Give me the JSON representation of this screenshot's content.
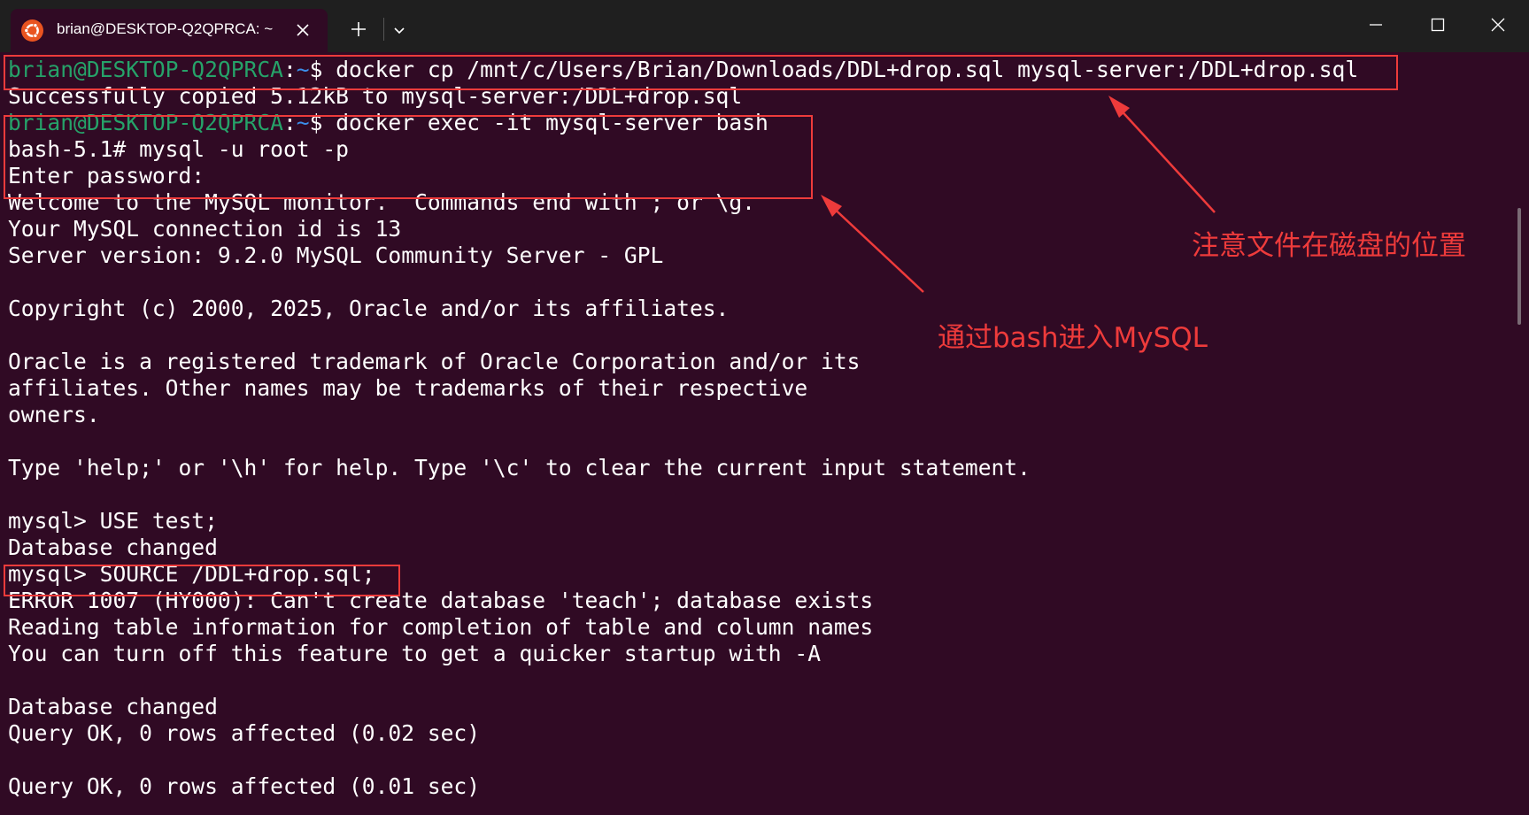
{
  "window": {
    "tab_title": "brian@DESKTOP-Q2QPRCA: ~",
    "tab_icon": "ubuntu-icon",
    "buttons": {
      "close_tab": "close-icon",
      "new_tab": "plus-icon",
      "dropdown": "chevron-down-icon",
      "minimize": "minimize-icon",
      "maximize": "maximize-icon",
      "close": "close-icon"
    }
  },
  "colors": {
    "terminal_bg": "#300a24",
    "prompt_user": "#26a269",
    "prompt_path": "#3b8eea",
    "annotation": "#ee3b3b"
  },
  "terminal": {
    "prompt": {
      "user": "brian@DESKTOP-Q2QPRCA",
      "sep": ":",
      "path": "~",
      "symbol": "$ "
    },
    "cmd1": "docker cp /mnt/c/Users/Brian/Downloads/DDL+drop.sql mysql-server:/DDL+drop.sql",
    "cmd2": "docker exec -it mysql-server bash",
    "lines": [
      "Successfully copied 5.12kB to mysql-server:/DDL+drop.sql",
      "bash-5.1# mysql -u root -p",
      "Enter password:",
      "Welcome to the MySQL monitor.  Commands end with ; or \\g.",
      "Your MySQL connection id is 13",
      "Server version: 9.2.0 MySQL Community Server - GPL",
      "",
      "Copyright (c) 2000, 2025, Oracle and/or its affiliates.",
      "",
      "Oracle is a registered trademark of Oracle Corporation and/or its",
      "affiliates. Other names may be trademarks of their respective",
      "owners.",
      "",
      "Type 'help;' or '\\h' for help. Type '\\c' to clear the current input statement.",
      "",
      "mysql> USE test;",
      "Database changed",
      "mysql> SOURCE /DDL+drop.sql;",
      "ERROR 1007 (HY000): Can't create database 'teach'; database exists",
      "Reading table information for completion of table and column names",
      "You can turn off this feature to get a quicker startup with -A",
      "",
      "Database changed",
      "Query OK, 0 rows affected (0.02 sec)",
      "",
      "Query OK, 0 rows affected (0.01 sec)"
    ]
  },
  "annotations": {
    "note1": "注意文件在磁盘的位置",
    "note2": "通过bash进入MySQL"
  }
}
